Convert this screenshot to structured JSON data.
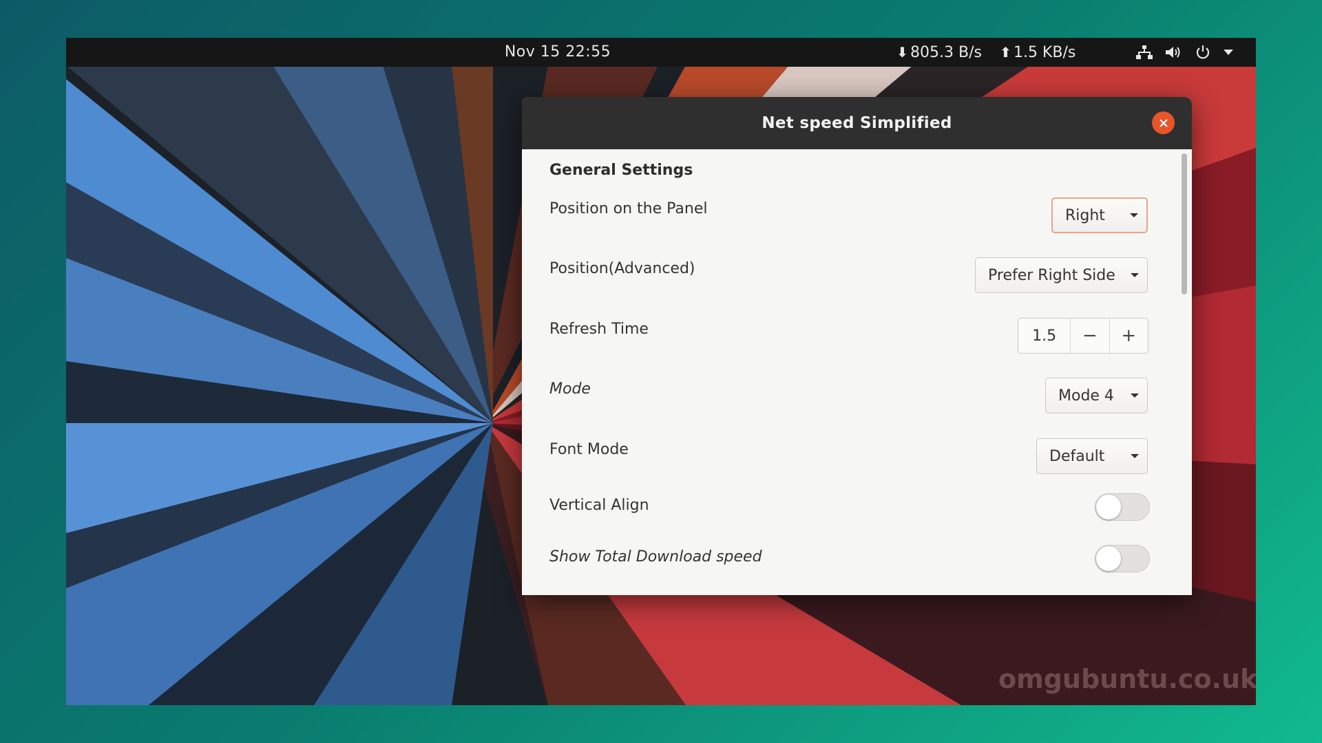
{
  "top_panel": {
    "clock": "Nov 15  22:55",
    "download_speed": "805.3 B/s",
    "upload_speed": "1.5 KB/s",
    "tray_icons": [
      "network-icon",
      "volume-icon",
      "power-icon",
      "chevron-down-icon"
    ]
  },
  "dialog": {
    "title": "Net speed Simplified",
    "section_heading": "General Settings",
    "rows": {
      "position_panel": {
        "label": "Position on the Panel",
        "value": "Right"
      },
      "position_advanced": {
        "label": "Position(Advanced)",
        "value": "Prefer Right Side"
      },
      "refresh_time": {
        "label": "Refresh Time",
        "value": "1.5",
        "minus": "−",
        "plus": "+"
      },
      "mode": {
        "label": "Mode",
        "value": "Mode 4"
      },
      "font_mode": {
        "label": "Font Mode",
        "value": "Default"
      },
      "vertical_align": {
        "label": "Vertical Align",
        "enabled": false
      },
      "show_total_download": {
        "label": "Show Total Download speed",
        "enabled": false
      }
    }
  },
  "watermark": "omgubuntu.co.uk",
  "colors": {
    "close_button": "#e9542a",
    "focus_border": "#e9a587",
    "panel": "#161616",
    "titlebar": "#2f2f2f"
  }
}
